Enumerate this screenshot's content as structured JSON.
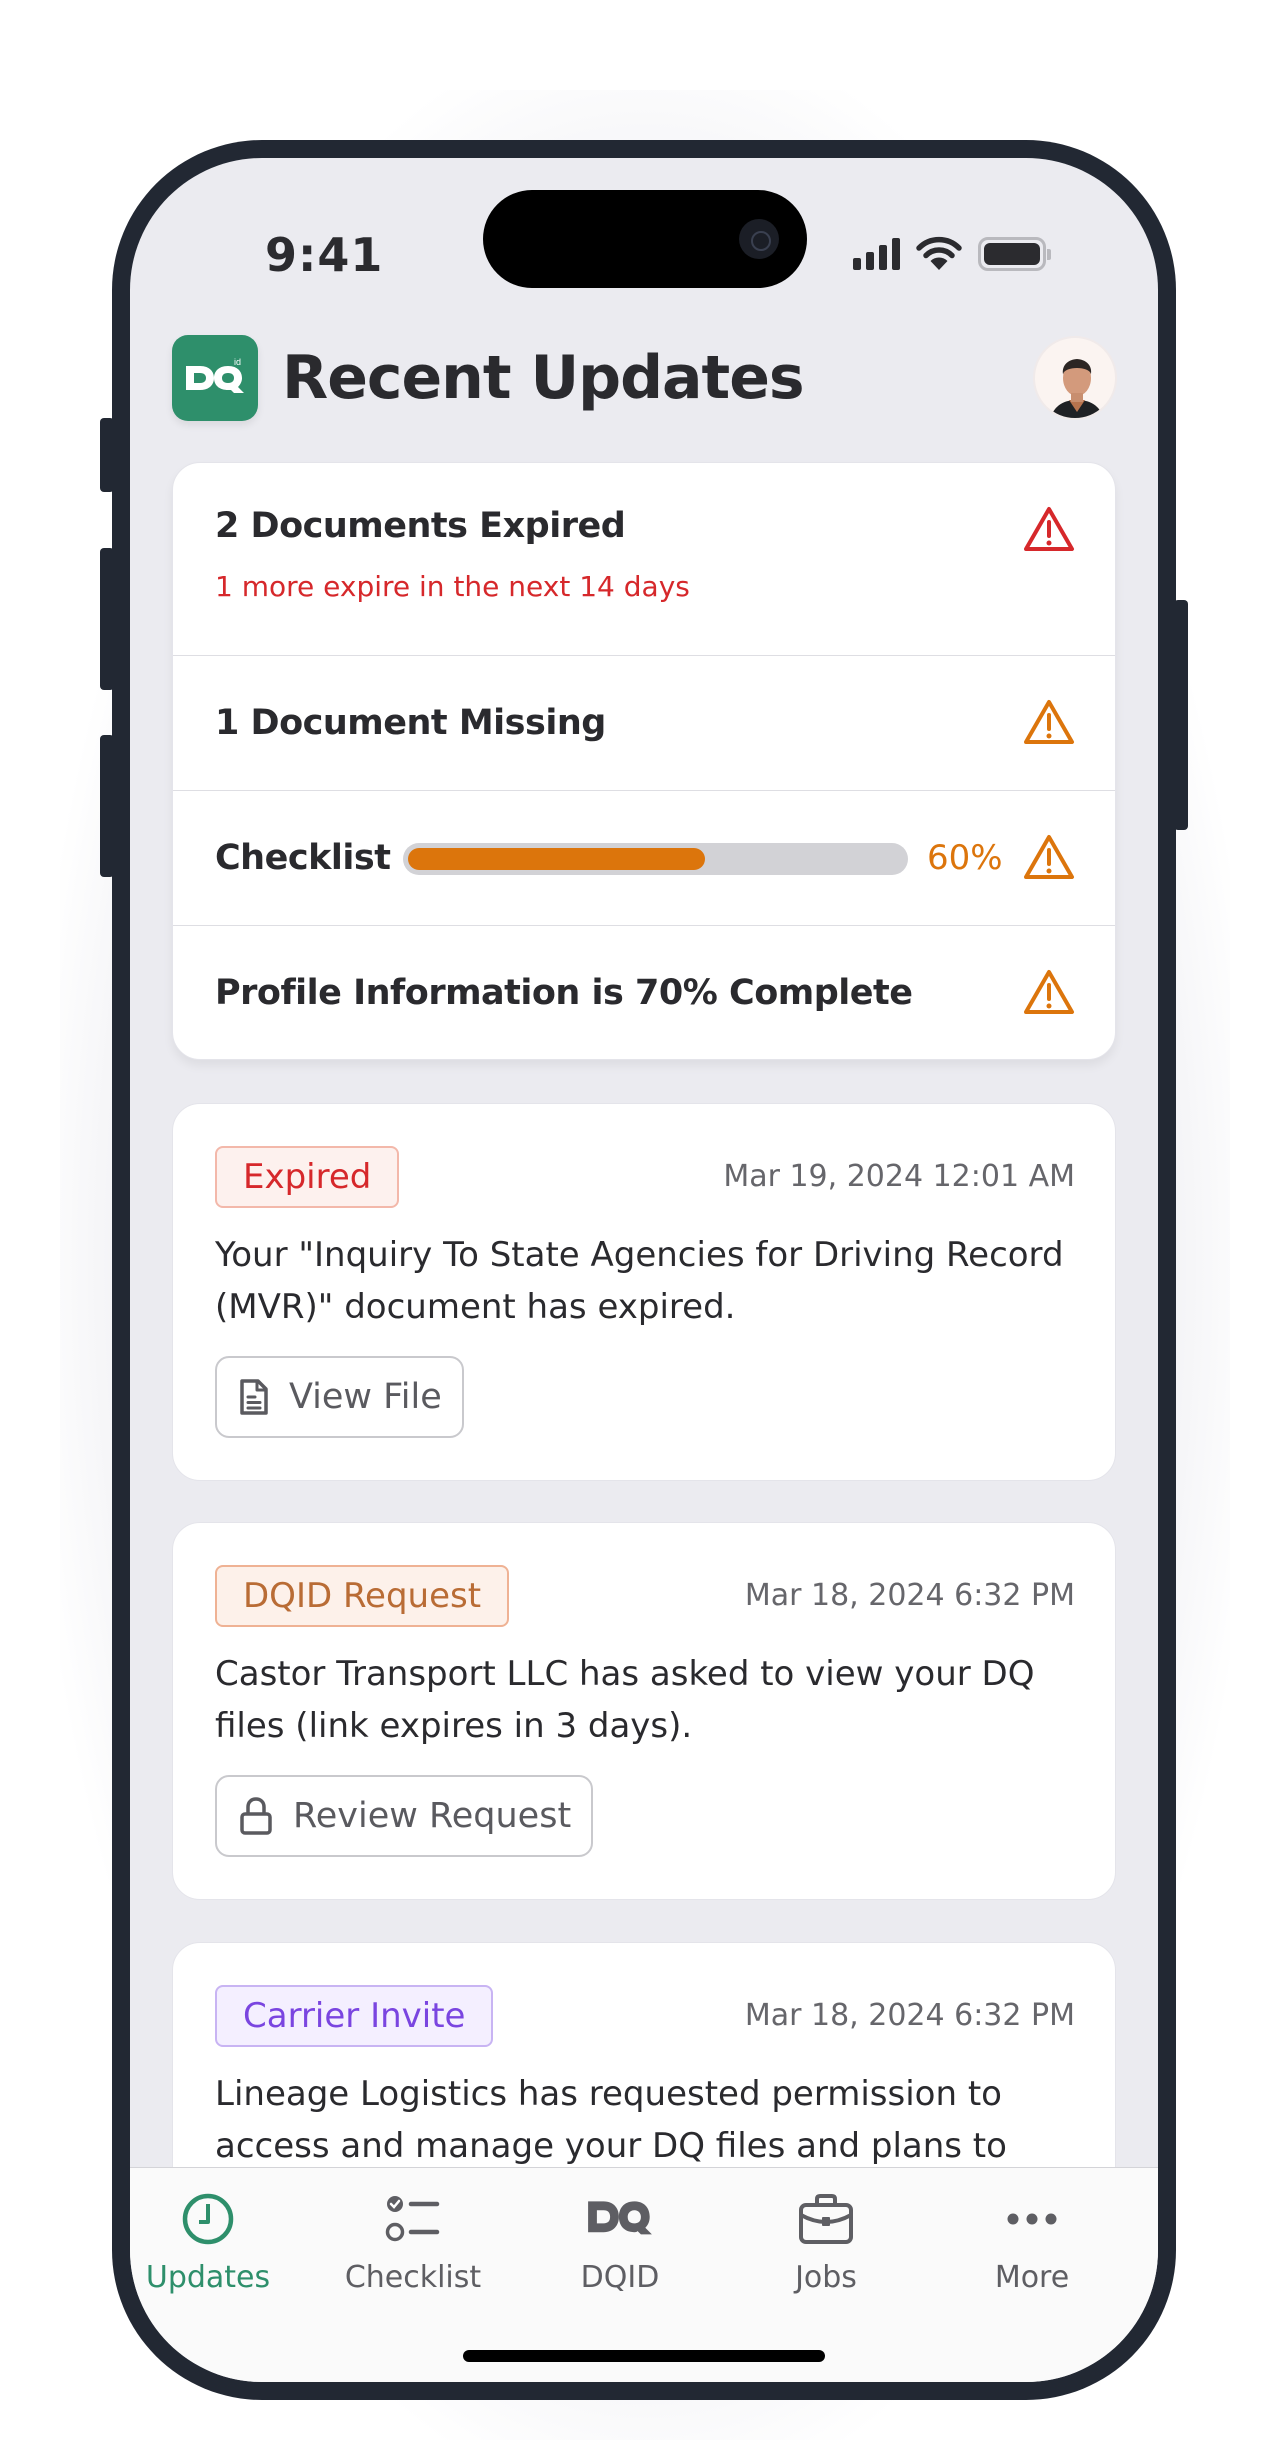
{
  "status_bar": {
    "time": "9:41"
  },
  "header": {
    "logo_text": "DQ",
    "logo_sup": "id",
    "title": "Recent Updates",
    "avatar_alt": "User avatar"
  },
  "summary": {
    "rows": [
      {
        "label": "2 Documents Expired",
        "sub": "1 more expire in the next 14 days",
        "severity": "error",
        "icon": "warning-triangle-icon"
      },
      {
        "label": "1 Document Missing",
        "severity": "warning",
        "icon": "warning-triangle-icon"
      },
      {
        "label": "Checklist",
        "progress_percent": 60,
        "progress_text": "60%",
        "severity": "warning",
        "icon": "warning-triangle-icon"
      },
      {
        "label": "Profile Information is 70% Complete",
        "severity": "warning",
        "icon": "warning-triangle-icon"
      }
    ]
  },
  "updates": [
    {
      "badge": "Expired",
      "badge_kind": "red",
      "timestamp": "Mar 19, 2024 12:01 AM",
      "message": "Your \"Inquiry To State Agencies for Driving Record (MVR)\" document has expired.",
      "action_label": "View File",
      "action_icon": "document-icon"
    },
    {
      "badge": "DQID Request",
      "badge_kind": "orange",
      "timestamp": "Mar 18, 2024 6:32 PM",
      "message": "Castor Transport LLC has asked to view your DQ files (link expires in 3 days).",
      "action_label": "Review Request",
      "action_icon": "lock-icon"
    },
    {
      "badge": "Carrier Invite",
      "badge_kind": "purple",
      "timestamp": "Mar 18, 2024 6:32 PM",
      "message": "Lineage Logistics has requested permission to access and manage your DQ files and plans to"
    }
  ],
  "tabbar": {
    "active": "Updates",
    "tabs": [
      {
        "label": "Updates",
        "icon": "clock-icon"
      },
      {
        "label": "Checklist",
        "icon": "checklist-icon"
      },
      {
        "label": "DQID",
        "icon": "dq-logo-icon"
      },
      {
        "label": "Jobs",
        "icon": "briefcase-icon"
      },
      {
        "label": "More",
        "icon": "more-dots-icon"
      }
    ]
  },
  "colors": {
    "brand_green": "#2e8f6b",
    "error_red": "#d6282b",
    "warning_orange": "#dc750c",
    "invite_purple": "#7a45e0",
    "frame": "#222833"
  }
}
